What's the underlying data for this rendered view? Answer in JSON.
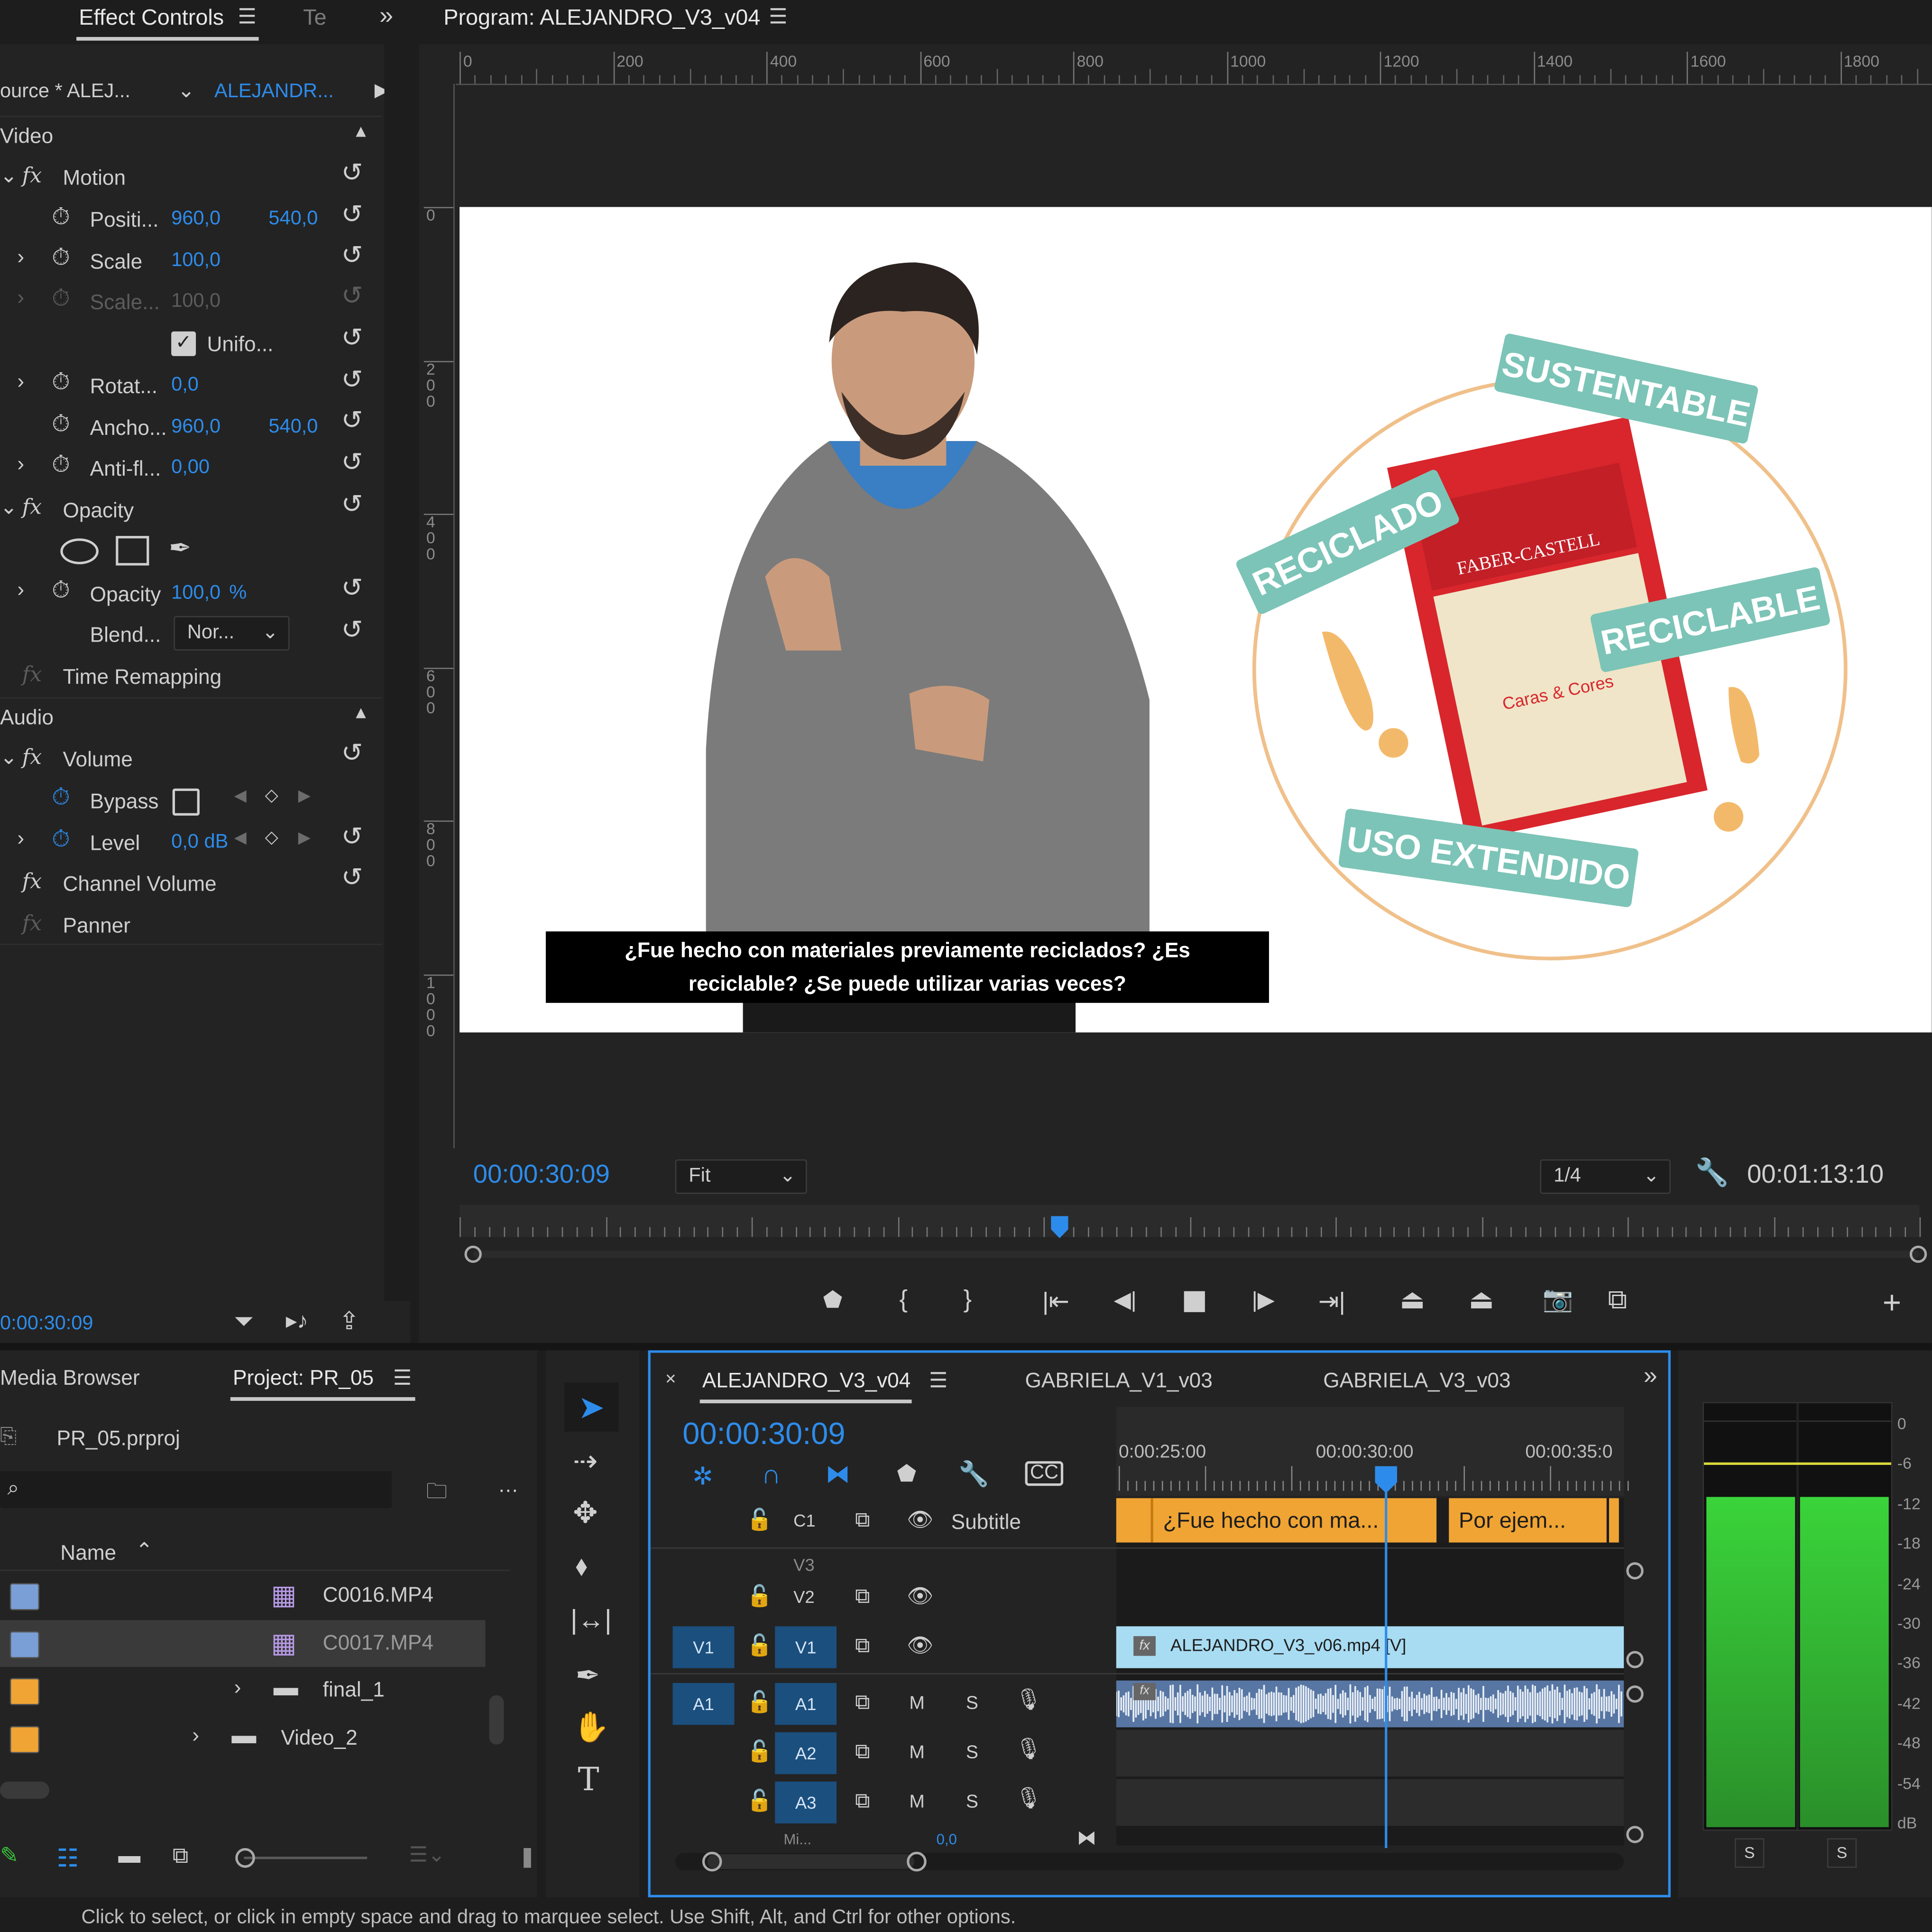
{
  "effect_controls": {
    "tabs": [
      "Effect Controls",
      "Te"
    ],
    "source_label": "ource * ALEJ...",
    "clip_label": "ALEJANDR...",
    "video_section": "Video",
    "motion": "Motion",
    "position": {
      "label": "Positi...",
      "x": "960,0",
      "y": "540,0"
    },
    "scale": {
      "label": "Scale",
      "value": "100,0"
    },
    "scale_width": {
      "label": "Scale...",
      "value": "100,0"
    },
    "uniform": {
      "label": "Unifo...",
      "checked": true
    },
    "rotation": {
      "label": "Rotat...",
      "value": "0,0"
    },
    "anchor": {
      "label": "Ancho...",
      "x": "960,0",
      "y": "540,0"
    },
    "antiflicker": {
      "label": "Anti-fl...",
      "value": "0,00"
    },
    "opacity_header": "Opacity",
    "opacity": {
      "label": "Opacity",
      "value": "100,0",
      "unit": "%"
    },
    "blend": {
      "label": "Blend...",
      "value": "Nor..."
    },
    "time_remapping": "Time Remapping",
    "audio_section": "Audio",
    "volume": "Volume",
    "bypass": "Bypass",
    "level": {
      "label": "Level",
      "value": "0,0 dB"
    },
    "channel_volume": "Channel Volume",
    "panner": "Panner",
    "timecode": "0:00:30:09"
  },
  "program_monitor": {
    "title": "Program: ALEJANDRO_V3_v04",
    "ruler_h": [
      "0",
      "200",
      "400",
      "600",
      "800",
      "1000",
      "1200",
      "1400",
      "1600",
      "1800"
    ],
    "ruler_v": [
      "0",
      "200",
      "400",
      "600",
      "800",
      "1000"
    ],
    "timecode": "00:00:30:09",
    "fit": "Fit",
    "resolution": "1/4",
    "duration": "00:01:13:10",
    "playhead_fraction": 0.411,
    "subtitle_line1": "¿Fue hecho con materiales previamente reciclados? ¿Es",
    "subtitle_line2": "reciclable? ¿Se puede utilizar varias veces?",
    "graphic_labels": [
      "SUSTENTABLE",
      "RECICLADO",
      "RECICLABLE",
      "USO EXTENDIDO"
    ],
    "product_brand": "FABER-CASTELL",
    "product_name": "Caras & Cores"
  },
  "project_panel": {
    "tabs": [
      "Media Browser",
      "Project: PR_05"
    ],
    "file": "PR_05.prproj",
    "search_placeholder": "",
    "column_name": "Name",
    "items": [
      {
        "name": "C0016.MP4",
        "color": "#7a9fd6",
        "type": "clip"
      },
      {
        "name": "C0017.MP4",
        "color": "#7a9fd6",
        "type": "clip",
        "selected": true
      },
      {
        "name": "final_1",
        "color": "#f0a433",
        "type": "folder"
      },
      {
        "name": "Video_2",
        "color": "#f0a433",
        "type": "folder"
      }
    ]
  },
  "timeline": {
    "tabs": [
      "ALEJANDRO_V3_v04",
      "GABRIELA_V1_v03",
      "GABRIELA_V3_v03"
    ],
    "timecode": "00:00:30:09",
    "ruler": [
      "0:00:25:00",
      "00:00:30:00",
      "00:00:35:0"
    ],
    "tracks": {
      "c1": "C1",
      "subtitle": "Subtitle",
      "v3": "V3",
      "v2": "V2",
      "v1": "V1",
      "v1_src": "V1",
      "a1": "A1",
      "a1_src": "A1",
      "a2": "A2",
      "a3": "A3",
      "mute": "M",
      "solo": "S"
    },
    "captions": [
      "¿Fue hecho con ma...",
      "Por ejem..."
    ],
    "video_clip": "ALEJANDRO_V3_v06.mp4 [V]",
    "mix_label": "Mi...",
    "mix_value": "0,0"
  },
  "audio_meter": {
    "scale": [
      "0",
      "-6",
      "-12",
      "-18",
      "-24",
      "-30",
      "-36",
      "-42",
      "-48",
      "-54",
      "dB"
    ],
    "solo_left": "S",
    "solo_right": "S"
  },
  "status_bar": "Click to select, or click in empty space and drag to marquee select. Use Shift, Alt, and Ctrl for other options.",
  "colors": {
    "accent": "#2d8ceb",
    "caption_clip": "#f0a433",
    "video_clip": "#a8dcf2",
    "audio_clip": "#5776a3",
    "meter_green": "#3ad43a"
  }
}
